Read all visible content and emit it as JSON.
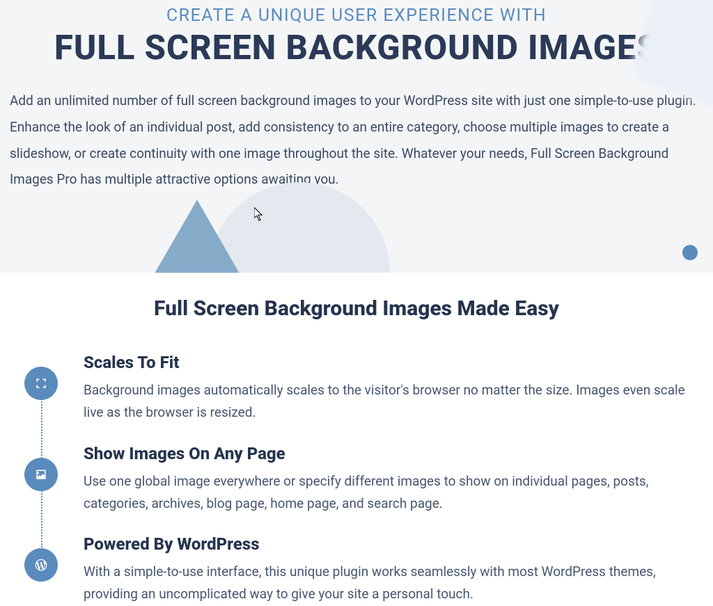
{
  "hero": {
    "overline": "CREATE A UNIQUE USER EXPERIENCE WITH",
    "headline": "FULL SCREEN BACKGROUND IMAGES",
    "intro": "Add an unlimited number of full screen background images to your WordPress site with just one simple-to-use plugin. Enhance the look of an individual post, add consistency to an entire category, choose multiple images to create a slideshow, or create continuity with one image throughout the site. Whatever your needs, Full Screen Background Images Pro has multiple attractive options awaiting you."
  },
  "section_title": "Full Screen Background Images Made Easy",
  "features": [
    {
      "title": "Scales To Fit",
      "desc": "Background images automatically scales to the visitor's browser no matter the size. Images even scale live as the browser is resized."
    },
    {
      "title": "Show Images On Any Page",
      "desc": "Use one global image everywhere or specify different images to show on individual pages, posts, categories, archives, blog page, home page, and search page."
    },
    {
      "title": "Powered By WordPress",
      "desc": "With a simple-to-use interface, this unique plugin works seamlessly with most WordPress themes, providing an uncomplicated way to give your site a personal touch."
    }
  ]
}
